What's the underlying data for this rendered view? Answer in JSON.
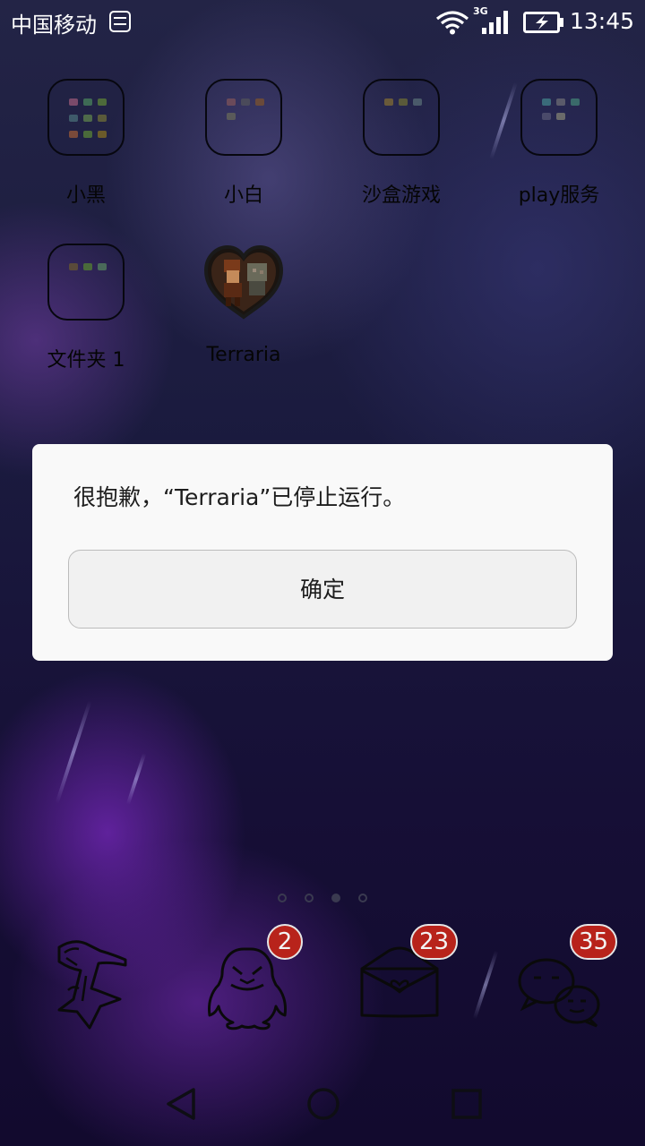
{
  "status_bar": {
    "carrier": "中国移动",
    "network_type": "3G",
    "time": "13:45",
    "icons": [
      "carrier-badge-icon",
      "wifi-icon",
      "signal-icon",
      "battery-charging-icon"
    ]
  },
  "desktop": {
    "apps": [
      {
        "label": "小黑",
        "icon": "folder-icon"
      },
      {
        "label": "小白",
        "icon": "folder-icon"
      },
      {
        "label": "沙盒游戏",
        "icon": "folder-icon"
      },
      {
        "label": "play服务",
        "icon": "folder-icon"
      },
      {
        "label": "文件夹 1",
        "icon": "folder-icon"
      },
      {
        "label": "Terraria",
        "icon": "terraria-heart-icon"
      }
    ],
    "page_count": 4,
    "current_page": 3
  },
  "dock": {
    "items": [
      {
        "icon": "tool-app-icon",
        "badge": ""
      },
      {
        "icon": "qq-penguin-icon",
        "badge": "2"
      },
      {
        "icon": "mail-icon",
        "badge": "23"
      },
      {
        "icon": "wechat-icon",
        "badge": "35"
      }
    ]
  },
  "dialog": {
    "message": "很抱歉，“Terraria”已停止运行。",
    "confirm_label": "确定"
  },
  "nav_bar": {
    "icons": [
      "back-icon",
      "home-icon",
      "recent-apps-icon"
    ]
  },
  "colors": {
    "badge": "#b8231b",
    "dialog_bg": "#f9f9f9",
    "wallpaper": "#1a1a3e"
  }
}
